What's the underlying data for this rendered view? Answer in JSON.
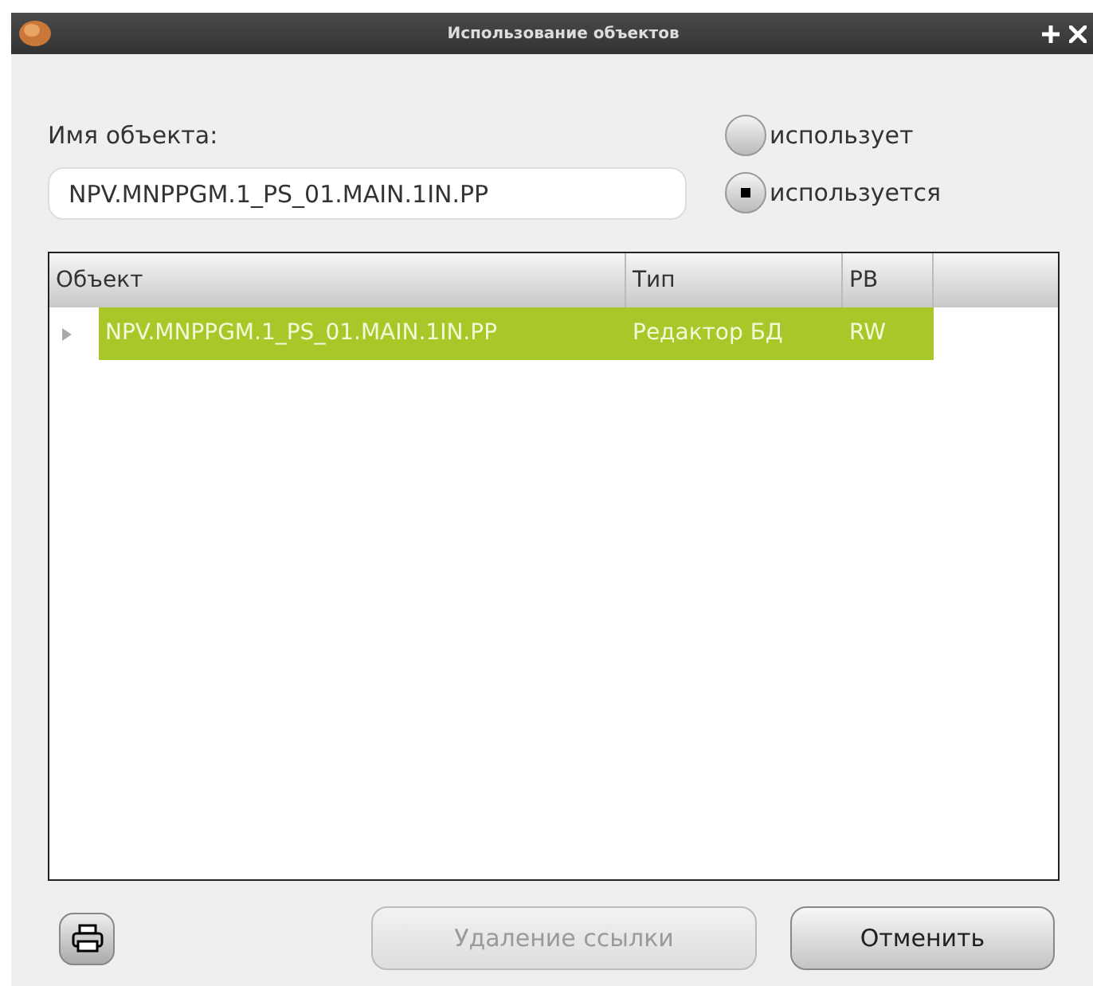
{
  "window": {
    "title": "Использование объектов"
  },
  "object_name": {
    "label": "Имя объекта:",
    "value": "NPV.MNPPGM.1_PS_01.MAIN.1IN.PP"
  },
  "modes": [
    {
      "label": "использует",
      "selected": false
    },
    {
      "label": "используется",
      "selected": true
    }
  ],
  "table": {
    "columns": [
      "Объект",
      "Тип",
      "РВ"
    ],
    "rows": [
      {
        "cells": [
          "NPV.MNPPGM.1_PS_01.MAIN.1IN.PP",
          "Редактор БД",
          "RW"
        ],
        "selected": true,
        "expanded": false
      }
    ]
  },
  "buttons": [
    {
      "label": "Удаление ссылки",
      "disabled": true
    },
    {
      "label": "Отменить",
      "disabled": false
    }
  ]
}
